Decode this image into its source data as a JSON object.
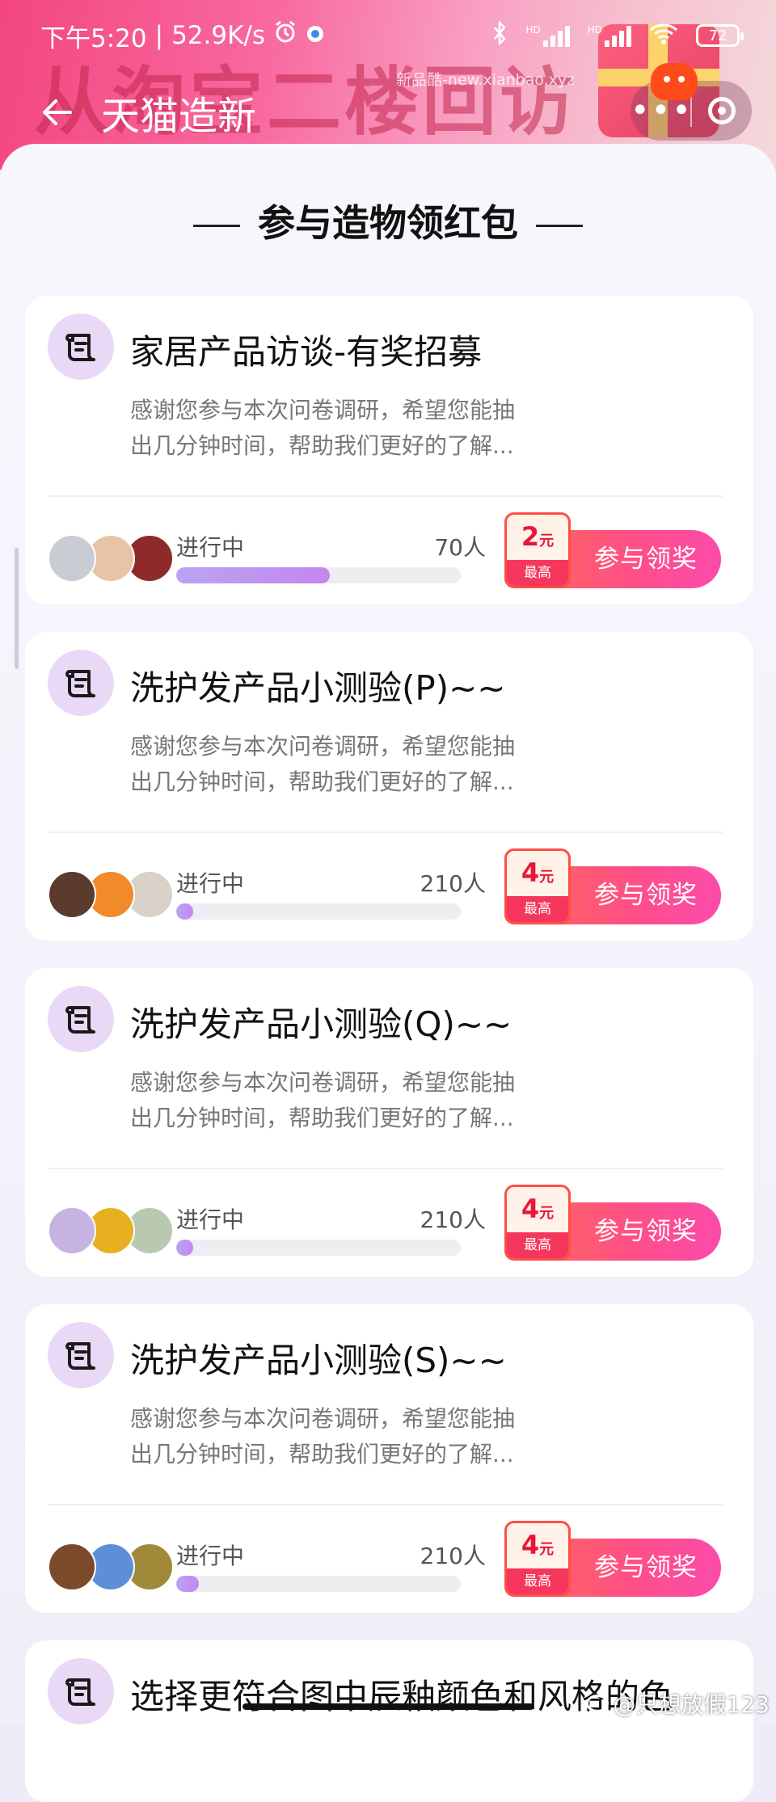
{
  "status_bar": {
    "time": "下午5:20",
    "net_speed": "52.9K/s",
    "alarm_icon": "alarm-clock-icon",
    "signal1_label": "HD",
    "signal2_label": "HD",
    "battery": "72"
  },
  "banner": {
    "headline": "从淘宝二楼回访",
    "watermark": "新品酷-new.xianbao.xyz"
  },
  "nav": {
    "title": "天猫造新",
    "more_label": "•••"
  },
  "section_title": "参与造物领红包",
  "cards": [
    {
      "title": "家居产品访谈-有奖招募",
      "desc_line1": "感谢您参与本次问卷调研，希望您能抽",
      "desc_line2": "出几分钟时间，帮助我们更好的了解...",
      "status": "进行中",
      "count": "70人",
      "progress": 0.54,
      "reward_amount": "2",
      "reward_unit": "元",
      "reward_foot": "最高",
      "button_label": "参与领奖",
      "avatar_colors": [
        "#c9cdd3",
        "#e8c4a6",
        "#8e2a2a"
      ]
    },
    {
      "title": "洗护发产品小测验(P)~~",
      "desc_line1": "感谢您参与本次问卷调研，希望您能抽",
      "desc_line2": "出几分钟时间，帮助我们更好的了解...",
      "status": "进行中",
      "count": "210人",
      "progress": 0.02,
      "reward_amount": "4",
      "reward_unit": "元",
      "reward_foot": "最高",
      "button_label": "参与领奖",
      "avatar_colors": [
        "#5b3b2e",
        "#f08a2a",
        "#d8d2c8"
      ]
    },
    {
      "title": "洗护发产品小测验(Q)~~",
      "desc_line1": "感谢您参与本次问卷调研，希望您能抽",
      "desc_line2": "出几分钟时间，帮助我们更好的了解...",
      "status": "进行中",
      "count": "210人",
      "progress": 0.02,
      "reward_amount": "4",
      "reward_unit": "元",
      "reward_foot": "最高",
      "button_label": "参与领奖",
      "avatar_colors": [
        "#c6b3e0",
        "#e8b020",
        "#b9c9b0"
      ]
    },
    {
      "title": "洗护发产品小测验(S)~~",
      "desc_line1": "感谢您参与本次问卷调研，希望您能抽",
      "desc_line2": "出几分钟时间，帮助我们更好的了解...",
      "status": "进行中",
      "count": "210人",
      "progress": 0.08,
      "reward_amount": "4",
      "reward_unit": "元",
      "reward_foot": "最高",
      "button_label": "参与领奖",
      "avatar_colors": [
        "#7a4a2a",
        "#5c8fd8",
        "#a08a3a"
      ]
    },
    {
      "title": "选择更符合图中辰釉颜色和风格的色"
    }
  ],
  "footer": {
    "weibo_handle": "@只想放假123"
  }
}
